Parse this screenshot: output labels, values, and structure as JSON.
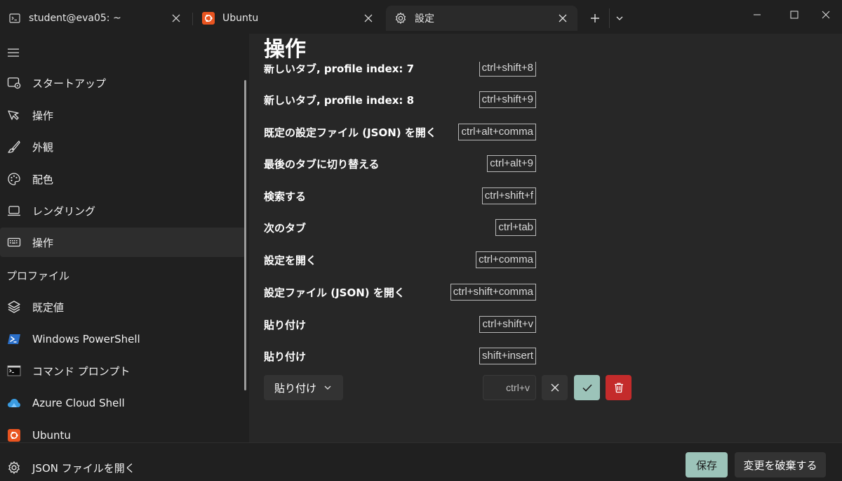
{
  "tabs": [
    {
      "title": "student@eva05: ~",
      "icon": "terminal-icon",
      "active": false
    },
    {
      "title": "Ubuntu",
      "icon": "ubuntu-icon",
      "active": false
    },
    {
      "title": "設定",
      "icon": "gear-icon",
      "active": true
    }
  ],
  "sidebar": {
    "items": [
      {
        "label": "スタートアップ",
        "icon": "startup-icon"
      },
      {
        "label": "操作",
        "icon": "interaction-icon"
      },
      {
        "label": "外観",
        "icon": "brush-icon"
      },
      {
        "label": "配色",
        "icon": "palette-icon"
      },
      {
        "label": "レンダリング",
        "icon": "monitor-icon"
      },
      {
        "label": "操作",
        "icon": "keyboard-icon",
        "selected": true
      }
    ],
    "profiles_header": "プロファイル",
    "profiles": [
      {
        "label": "既定値",
        "icon": "layers-icon"
      },
      {
        "label": "Windows PowerShell",
        "icon": "powershell-icon"
      },
      {
        "label": "コマンド プロンプト",
        "icon": "cmd-icon"
      },
      {
        "label": "Azure Cloud Shell",
        "icon": "azure-cloud-icon"
      },
      {
        "label": "Ubuntu",
        "icon": "ubuntu-icon"
      }
    ],
    "open_json": {
      "label": "JSON ファイルを開く",
      "icon": "gear-icon"
    }
  },
  "main": {
    "title": "操作",
    "bindings": [
      {
        "action": "新しいタブ, profile index: 7",
        "keys": "ctrl+shift+8"
      },
      {
        "action": "新しいタブ, profile index: 8",
        "keys": "ctrl+shift+9"
      },
      {
        "action": "既定の設定ファイル (JSON) を開く",
        "keys": "ctrl+alt+comma"
      },
      {
        "action": "最後のタブに切り替える",
        "keys": "ctrl+alt+9"
      },
      {
        "action": "検索する",
        "keys": "ctrl+shift+f"
      },
      {
        "action": "次のタブ",
        "keys": "ctrl+tab"
      },
      {
        "action": "設定を開く",
        "keys": "ctrl+comma"
      },
      {
        "action": "設定ファイル (JSON) を開く",
        "keys": "ctrl+shift+comma"
      },
      {
        "action": "貼り付け",
        "keys": "ctrl+shift+v"
      },
      {
        "action": "貼り付け",
        "keys": "shift+insert"
      }
    ],
    "edit_row": {
      "action_selected": "貼り付け",
      "keys_value": "ctrl+v"
    }
  },
  "footer": {
    "save_label": "保存",
    "discard_label": "変更を破棄する"
  },
  "colors": {
    "accent": "#9cc3b9",
    "danger": "#c42b2b",
    "ubuntu": "#e95420"
  }
}
